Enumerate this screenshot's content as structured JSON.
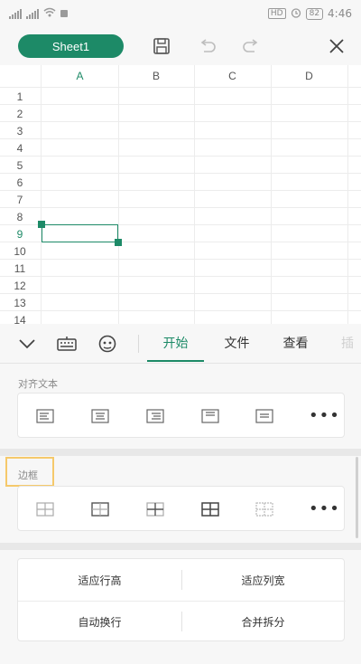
{
  "statusbar": {
    "carrier": "",
    "badge_hd": "HD",
    "battery": "82",
    "time": "4:46"
  },
  "toolbar": {
    "sheet_name": "Sheet1",
    "save": "save-icon",
    "undo": "undo-icon",
    "redo": "redo-icon",
    "close": "close-icon"
  },
  "grid": {
    "columns": [
      "A",
      "B",
      "C",
      "D"
    ],
    "rows": [
      "1",
      "2",
      "3",
      "4",
      "5",
      "6",
      "7",
      "8",
      "9",
      "10",
      "11",
      "12",
      "13",
      "14"
    ],
    "active_column": "A",
    "active_row": "9"
  },
  "ribbon": {
    "tabs": [
      "开始",
      "文件",
      "查看",
      "插"
    ],
    "active_tab": "开始"
  },
  "sections": {
    "align_title": "对齐文本",
    "border_title": "边框"
  },
  "buttons": {
    "fit_row_height": "适应行高",
    "fit_col_width": "适应列宽",
    "wrap_text": "自动换行",
    "merge_split": "合并拆分"
  },
  "colors": {
    "accent": "#1d8a67",
    "highlight": "#f5c96b"
  }
}
